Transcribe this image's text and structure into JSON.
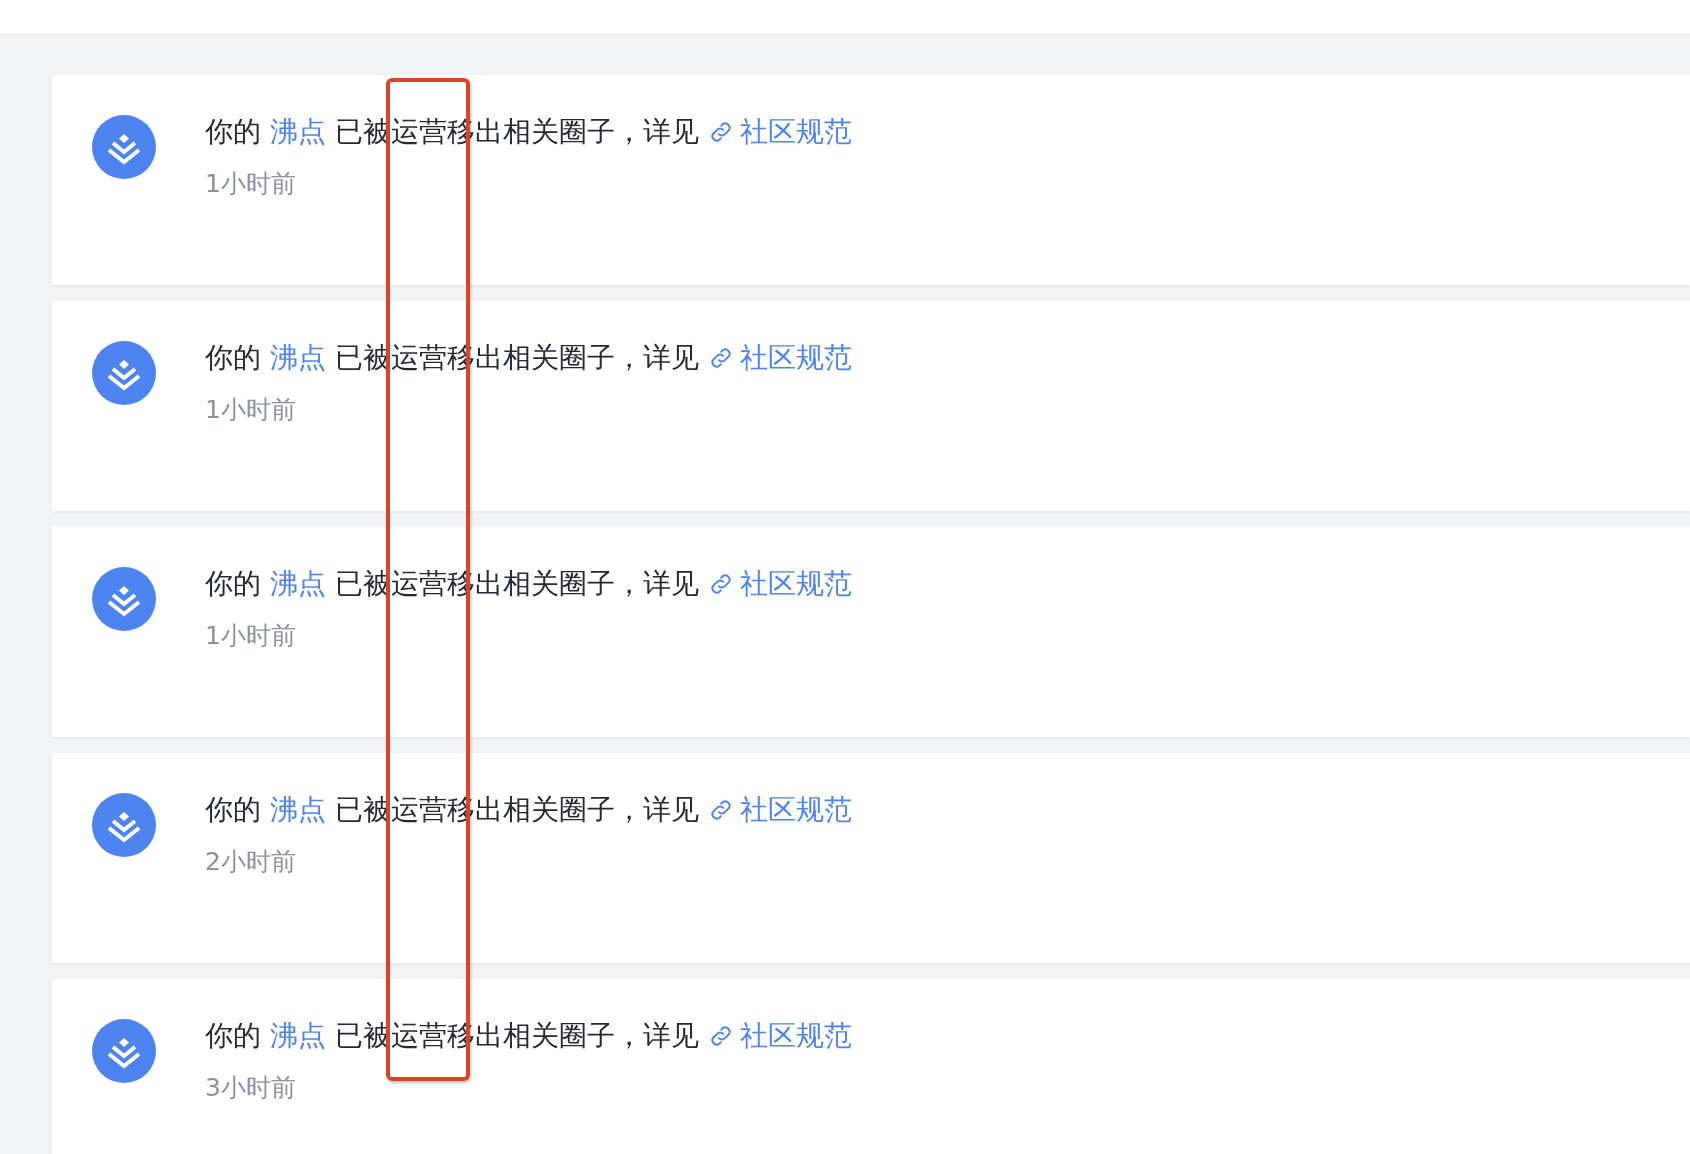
{
  "notifications": [
    {
      "prefix": "你的",
      "post_link": "沸点",
      "message": "已被运营移出相关圈子，详见",
      "rule_link": "社区规范",
      "time": "1小时前"
    },
    {
      "prefix": "你的",
      "post_link": "沸点",
      "message": "已被运营移出相关圈子，详见",
      "rule_link": "社区规范",
      "time": "1小时前"
    },
    {
      "prefix": "你的",
      "post_link": "沸点",
      "message": "已被运营移出相关圈子，详见",
      "rule_link": "社区规范",
      "time": "1小时前"
    },
    {
      "prefix": "你的",
      "post_link": "沸点",
      "message": "已被运营移出相关圈子，详见",
      "rule_link": "社区规范",
      "time": "2小时前"
    },
    {
      "prefix": "你的",
      "post_link": "沸点",
      "message": "已被运营移出相关圈子，详见",
      "rule_link": "社区规范",
      "time": "3小时前"
    }
  ]
}
